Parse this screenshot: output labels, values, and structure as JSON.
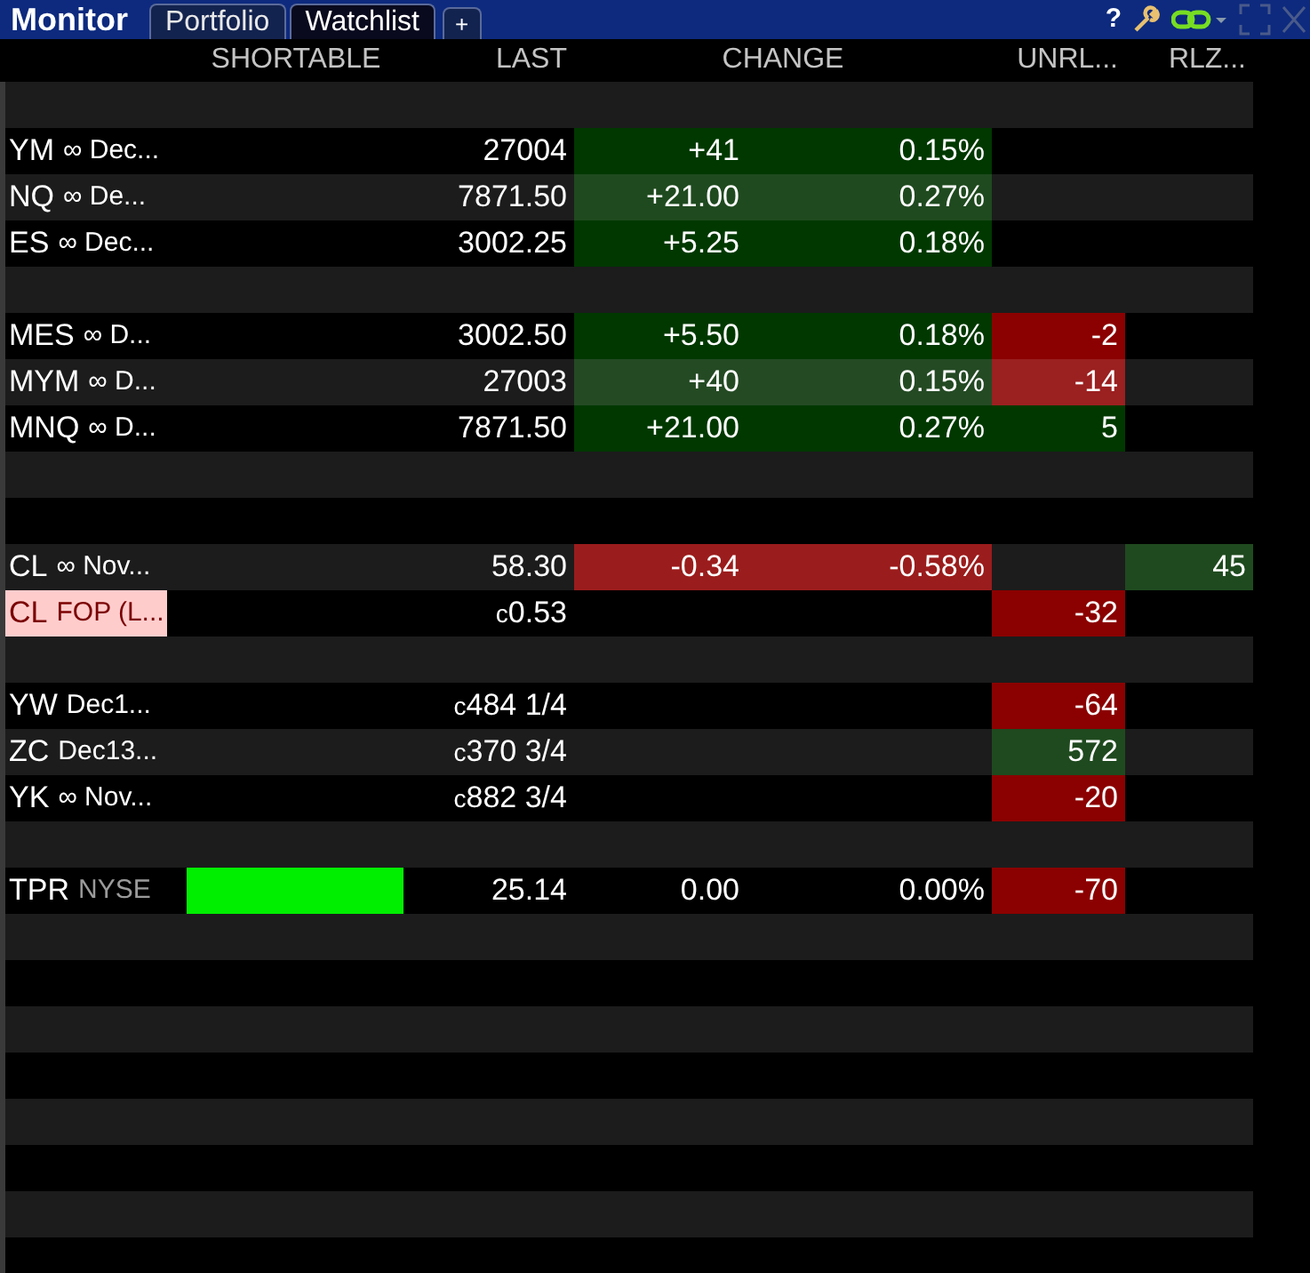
{
  "window": {
    "title": "Monitor"
  },
  "tabs": [
    {
      "label": "Portfolio",
      "selected": false
    },
    {
      "label": "Watchlist",
      "selected": true
    }
  ],
  "add_tab": {
    "label": "+"
  },
  "help": {
    "label": "?"
  },
  "header": {
    "shortable": "SHORTABLE",
    "last": "LAST",
    "change": "CHANGE",
    "unrl": "UNRL...",
    "rlz": "RLZ..."
  },
  "rows": [
    {
      "kind": "blank"
    },
    {
      "kind": "quote",
      "ticker": "YM",
      "detail": "∞ Dec...",
      "highlight": false,
      "detail_muted": false,
      "shortable": false,
      "last": "27004",
      "change": {
        "text": "+41",
        "color": "#003800"
      },
      "change_pct": {
        "text": "0.15%",
        "color": "#003800"
      }
    },
    {
      "kind": "quote",
      "ticker": "NQ",
      "detail": "∞ De...",
      "highlight": false,
      "detail_muted": false,
      "shortable": false,
      "last": "7871.50",
      "change": {
        "text": "+21.00",
        "color": "#1f4a1f"
      },
      "change_pct": {
        "text": "0.27%",
        "color": "#1f4a1f"
      }
    },
    {
      "kind": "quote",
      "ticker": "ES",
      "detail": "∞ Dec...",
      "highlight": false,
      "detail_muted": false,
      "shortable": false,
      "last": "3002.25",
      "change": {
        "text": "+5.25",
        "color": "#003800"
      },
      "change_pct": {
        "text": "0.18%",
        "color": "#003800"
      }
    },
    {
      "kind": "blank"
    },
    {
      "kind": "quote",
      "ticker": "MES",
      "detail": "∞ D...",
      "highlight": false,
      "detail_muted": false,
      "shortable": false,
      "last": "3002.50",
      "change": {
        "text": "+5.50",
        "color": "#003800"
      },
      "change_pct": {
        "text": "0.18%",
        "color": "#003800"
      },
      "unrl": {
        "text": "-2",
        "color": "#8b0000"
      }
    },
    {
      "kind": "quote",
      "ticker": "MYM",
      "detail": "∞ D...",
      "highlight": false,
      "detail_muted": false,
      "shortable": false,
      "last": "27003",
      "change": {
        "text": "+40",
        "color": "#244a24"
      },
      "change_pct": {
        "text": "0.15%",
        "color": "#244a24"
      },
      "unrl": {
        "text": "-14",
        "color": "#9b2020"
      }
    },
    {
      "kind": "quote",
      "ticker": "MNQ",
      "detail": "∞ D...",
      "highlight": false,
      "detail_muted": false,
      "shortable": false,
      "last": "7871.50",
      "change": {
        "text": "+21.00",
        "color": "#003800"
      },
      "change_pct": {
        "text": "0.27%",
        "color": "#003800"
      },
      "unrl": {
        "text": "5",
        "color": "#003800"
      }
    },
    {
      "kind": "blank"
    },
    {
      "kind": "blank"
    },
    {
      "kind": "quote",
      "ticker": "CL",
      "detail": "∞ Nov...",
      "highlight": false,
      "detail_muted": false,
      "shortable": false,
      "last": "58.30",
      "change": {
        "text": "-0.34",
        "color": "#9b1c1c"
      },
      "change_pct": {
        "text": "-0.58%",
        "color": "#9b1c1c"
      },
      "rlz": {
        "text": "45",
        "color": "#1f4a1f"
      }
    },
    {
      "kind": "quote",
      "ticker": "CL",
      "detail": "FOP (L...",
      "highlight": true,
      "detail_muted": false,
      "shortable": false,
      "last_prefix": "c",
      "last": "0.53",
      "unrl": {
        "text": "-32",
        "color": "#8b0000"
      }
    },
    {
      "kind": "blank"
    },
    {
      "kind": "quote",
      "ticker": "YW",
      "detail": "Dec1...",
      "highlight": false,
      "detail_muted": false,
      "shortable": false,
      "last_prefix": "c",
      "last": "484 1/4",
      "unrl": {
        "text": "-64",
        "color": "#8b0000"
      }
    },
    {
      "kind": "quote",
      "ticker": "ZC",
      "detail": "Dec13...",
      "highlight": false,
      "detail_muted": false,
      "shortable": false,
      "last_prefix": "c",
      "last": "370 3/4",
      "unrl": {
        "text": "572",
        "color": "#1f4a1f"
      }
    },
    {
      "kind": "quote",
      "ticker": "YK",
      "detail": "∞ Nov...",
      "highlight": false,
      "detail_muted": false,
      "shortable": false,
      "last_prefix": "c",
      "last": "882 3/4",
      "unrl": {
        "text": "-20",
        "color": "#8b0000"
      }
    },
    {
      "kind": "blank"
    },
    {
      "kind": "quote",
      "ticker": "TPR",
      "detail": "NYSE",
      "highlight": false,
      "detail_muted": true,
      "shortable": true,
      "last": "25.14",
      "change": {
        "text": "0.00"
      },
      "change_pct": {
        "text": "0.00%"
      },
      "unrl": {
        "text": "-70",
        "color": "#8b0000"
      }
    },
    {
      "kind": "blank"
    },
    {
      "kind": "blank"
    },
    {
      "kind": "blank"
    },
    {
      "kind": "blank"
    },
    {
      "kind": "blank"
    },
    {
      "kind": "blank"
    },
    {
      "kind": "blank"
    },
    {
      "kind": "blank"
    }
  ]
}
